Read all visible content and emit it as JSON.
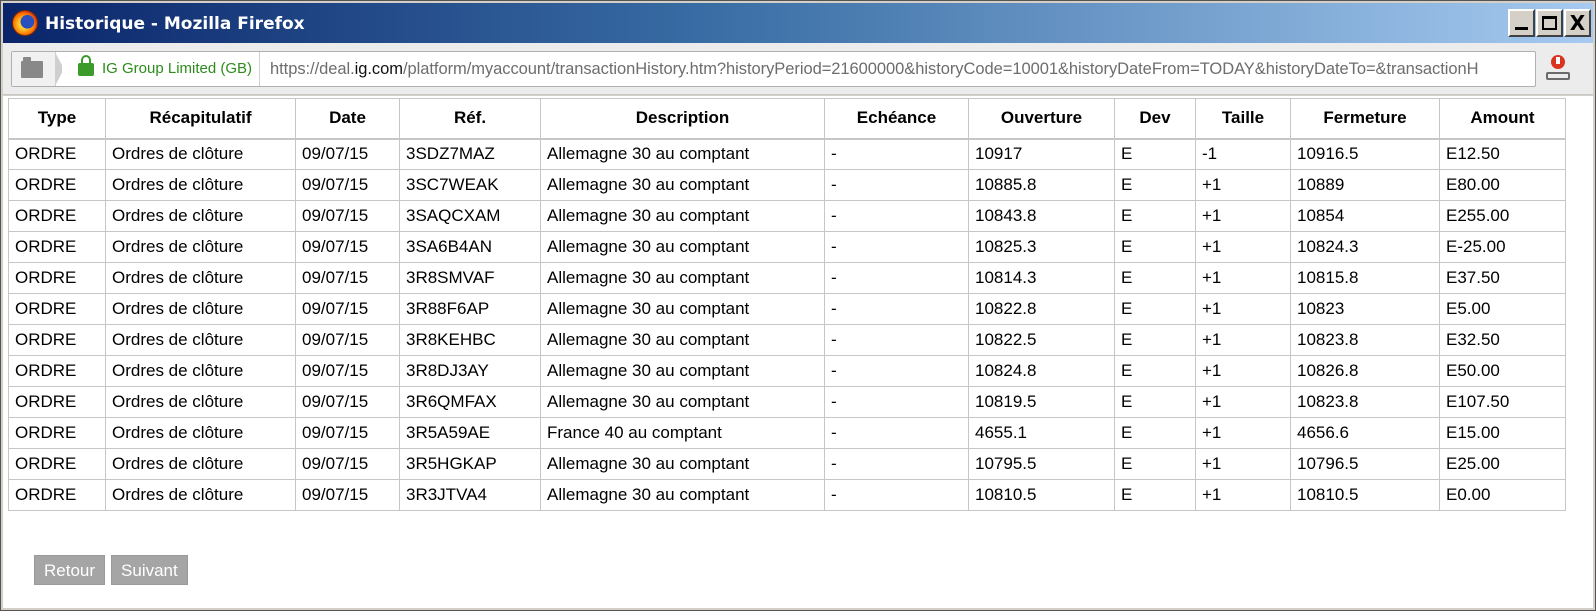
{
  "window": {
    "title": "Historique - Mozilla Firefox",
    "min_glyph": "_",
    "max_glyph": "□",
    "close_glyph": "X"
  },
  "urlbar": {
    "identity": "IG Group Limited (GB)",
    "url_prefix": "https://deal.",
    "url_domain": "ig.com",
    "url_rest": "/platform/myaccount/transactionHistory.htm?historyPeriod=21600000&historyCode=10001&historyDateFrom=TODAY&historyDateTo=&transactionH"
  },
  "table": {
    "columns": [
      "Type",
      "Récapitulatif",
      "Date",
      "Réf.",
      "Description",
      "Echéance",
      "Ouverture",
      "Dev",
      "Taille",
      "Fermeture",
      "Amount"
    ],
    "rows": [
      [
        "ORDRE",
        "Ordres de clôture",
        "09/07/15",
        "3SDZ7MAZ",
        "Allemagne 30 au comptant",
        "-",
        "10917",
        "E",
        "-1",
        "10916.5",
        "E12.50"
      ],
      [
        "ORDRE",
        "Ordres de clôture",
        "09/07/15",
        "3SC7WEAK",
        "Allemagne 30 au comptant",
        "-",
        "10885.8",
        "E",
        "+1",
        "10889",
        "E80.00"
      ],
      [
        "ORDRE",
        "Ordres de clôture",
        "09/07/15",
        "3SAQCXAM",
        "Allemagne 30 au comptant",
        "-",
        "10843.8",
        "E",
        "+1",
        "10854",
        "E255.00"
      ],
      [
        "ORDRE",
        "Ordres de clôture",
        "09/07/15",
        "3SA6B4AN",
        "Allemagne 30 au comptant",
        "-",
        "10825.3",
        "E",
        "+1",
        "10824.3",
        "E-25.00"
      ],
      [
        "ORDRE",
        "Ordres de clôture",
        "09/07/15",
        "3R8SMVAF",
        "Allemagne 30 au comptant",
        "-",
        "10814.3",
        "E",
        "+1",
        "10815.8",
        "E37.50"
      ],
      [
        "ORDRE",
        "Ordres de clôture",
        "09/07/15",
        "3R88F6AP",
        "Allemagne 30 au comptant",
        "-",
        "10822.8",
        "E",
        "+1",
        "10823",
        "E5.00"
      ],
      [
        "ORDRE",
        "Ordres de clôture",
        "09/07/15",
        "3R8KEHBC",
        "Allemagne 30 au comptant",
        "-",
        "10822.5",
        "E",
        "+1",
        "10823.8",
        "E32.50"
      ],
      [
        "ORDRE",
        "Ordres de clôture",
        "09/07/15",
        "3R8DJ3AY",
        "Allemagne 30 au comptant",
        "-",
        "10824.8",
        "E",
        "+1",
        "10826.8",
        "E50.00"
      ],
      [
        "ORDRE",
        "Ordres de clôture",
        "09/07/15",
        "3R6QMFAX",
        "Allemagne 30 au comptant",
        "-",
        "10819.5",
        "E",
        "+1",
        "10823.8",
        "E107.50"
      ],
      [
        "ORDRE",
        "Ordres de clôture",
        "09/07/15",
        "3R5A59AE",
        "France 40 au comptant",
        "-",
        "4655.1",
        "E",
        "+1",
        "4656.6",
        "E15.00"
      ],
      [
        "ORDRE",
        "Ordres de clôture",
        "09/07/15",
        "3R5HGKAP",
        "Allemagne 30 au comptant",
        "-",
        "10795.5",
        "E",
        "+1",
        "10796.5",
        "E25.00"
      ],
      [
        "ORDRE",
        "Ordres de clôture",
        "09/07/15",
        "3R3JTVA4",
        "Allemagne 30 au comptant",
        "-",
        "10810.5",
        "E",
        "+1",
        "10810.5",
        "E0.00"
      ]
    ]
  },
  "pagination": {
    "back_label": "Retour",
    "next_label": "Suivant"
  }
}
